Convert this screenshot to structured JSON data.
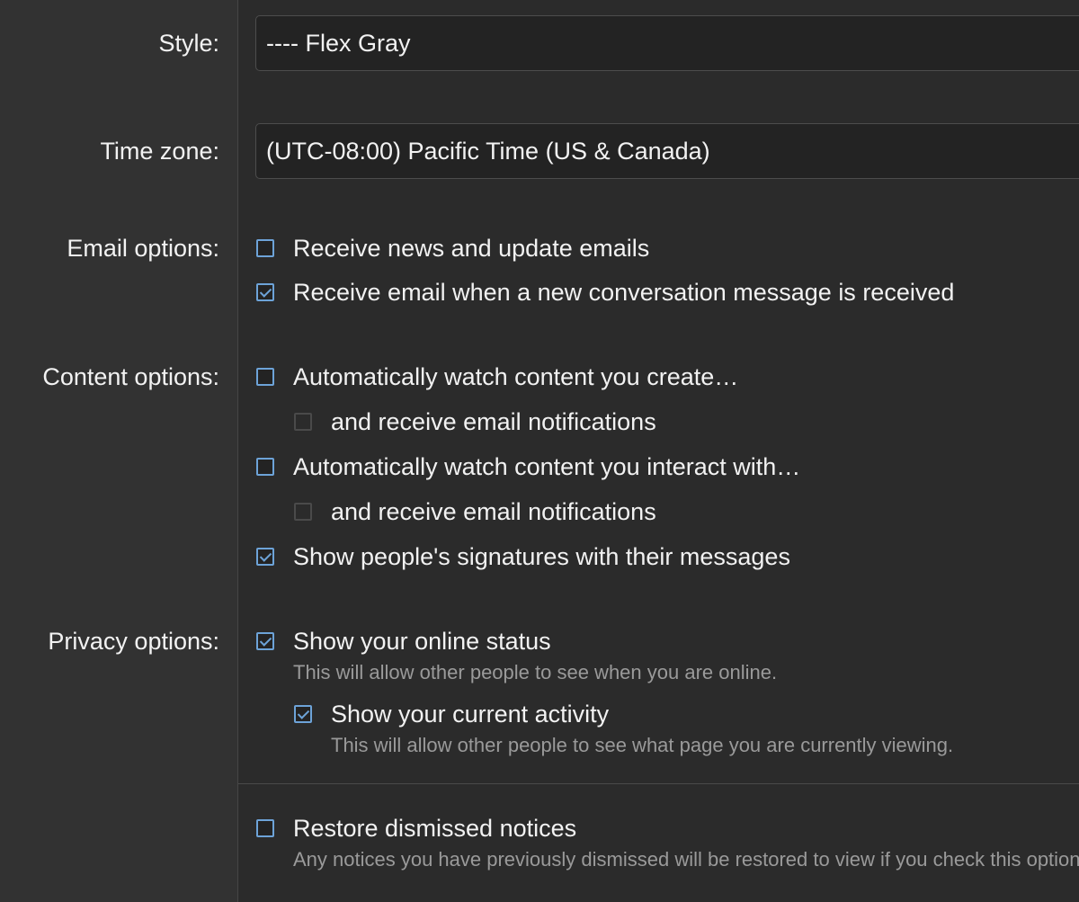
{
  "labels": {
    "style": "Style:",
    "time_zone": "Time zone:",
    "email_options": "Email options:",
    "content_options": "Content options:",
    "privacy_options": "Privacy options:"
  },
  "style_select": {
    "value": "---- Flex Gray"
  },
  "timezone_select": {
    "value": "(UTC-08:00) Pacific Time (US & Canada)"
  },
  "email_options": [
    {
      "label": "Receive news and update emails",
      "checked": false
    },
    {
      "label": "Receive email when a new conversation message is received",
      "checked": true
    }
  ],
  "content_options": {
    "watch_created": {
      "label": "Automatically watch content you create…",
      "checked": false
    },
    "watch_created_email": {
      "label": "and receive email notifications",
      "checked": false,
      "disabled": true
    },
    "watch_interacted": {
      "label": "Automatically watch content you interact with…",
      "checked": false
    },
    "watch_interacted_email": {
      "label": "and receive email notifications",
      "checked": false,
      "disabled": true
    },
    "show_signatures": {
      "label": "Show people's signatures with their messages",
      "checked": true
    }
  },
  "privacy_options": {
    "online_status": {
      "label": "Show your online status",
      "hint": "This will allow other people to see when you are online.",
      "checked": true
    },
    "current_activity": {
      "label": "Show your current activity",
      "hint": "This will allow other people to see what page you are currently viewing.",
      "checked": true
    }
  },
  "restore_notices": {
    "label": "Restore dismissed notices",
    "hint": "Any notices you have previously dismissed will be restored to view if you check this option.",
    "checked": false
  },
  "colors": {
    "background": "#2b2b2b",
    "label_column": "#323232",
    "accent": "#6da3d8",
    "hint_text": "#9a9a9a"
  }
}
